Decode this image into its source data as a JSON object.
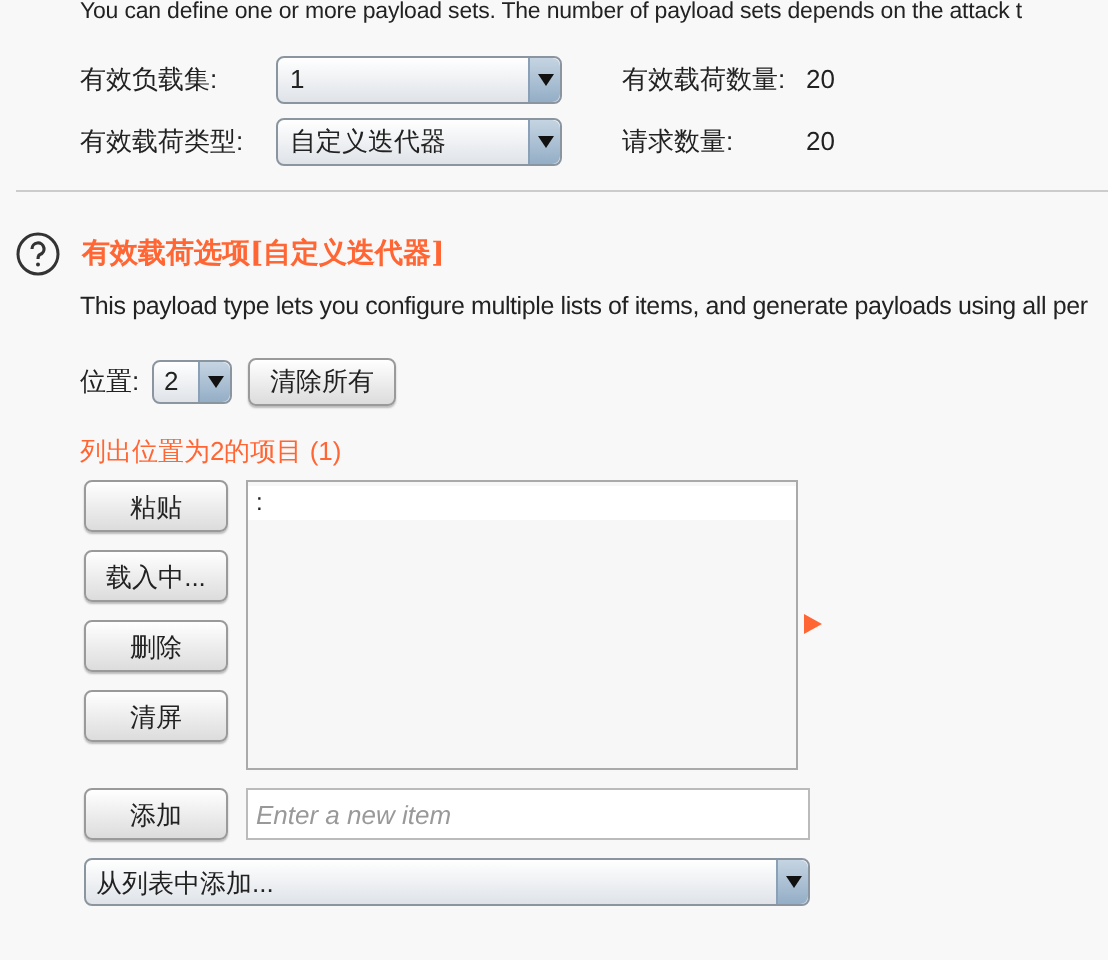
{
  "intro_text": "You can define one or more payload sets. The number of payload sets depends on the attack t",
  "settings": [
    {
      "label": "有效负载集:",
      "value": "1",
      "info_label": "有效载荷数量:",
      "info_value": "20"
    },
    {
      "label": "有效载荷类型:",
      "value": "自定义迭代器",
      "info_label": "请求数量:",
      "info_value": "20"
    }
  ],
  "section": {
    "title": "有效载荷选项[自定义迭代器]",
    "description": "This payload type lets you configure multiple lists of items, and generate payloads using all per"
  },
  "position": {
    "label": "位置:",
    "value": "2",
    "clear_button": "清除所有"
  },
  "list_heading": "列出位置为2的项目 (1)",
  "list_buttons": [
    "粘贴",
    "载入中...",
    "删除",
    "清屏"
  ],
  "list_items": [
    {
      "text": ":",
      "selected": false
    }
  ],
  "add_button": "添加",
  "new_item": {
    "placeholder": "Enter a new item"
  },
  "add_from_list": "从列表中添加..."
}
